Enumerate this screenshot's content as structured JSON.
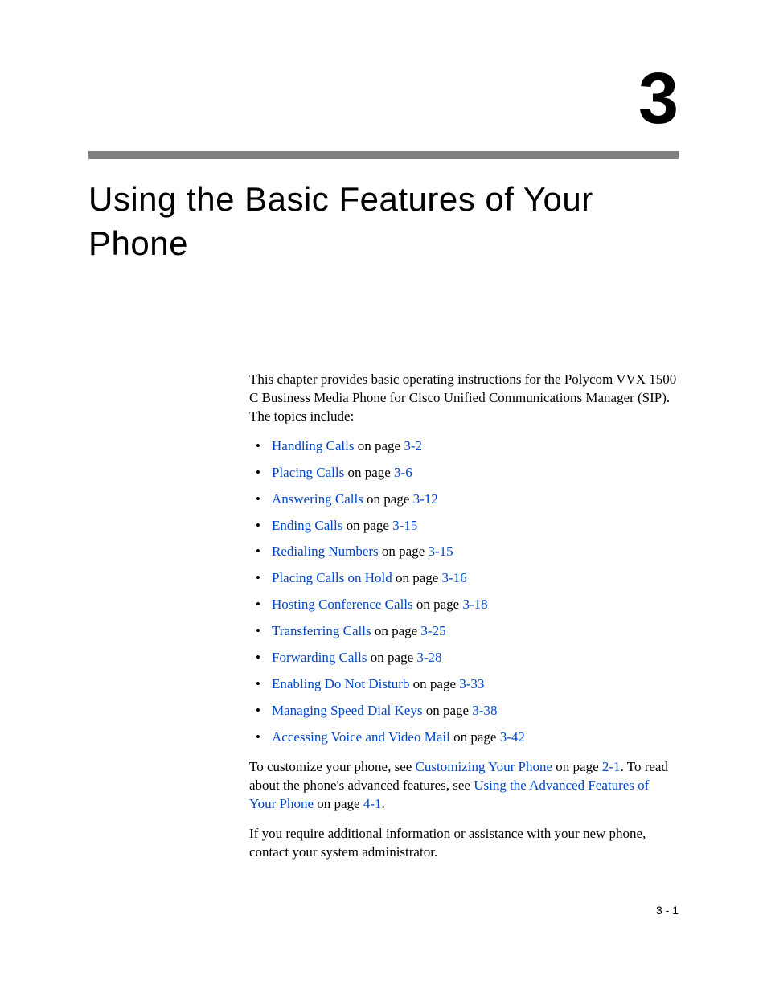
{
  "chapter": {
    "number": "3",
    "title": "Using the Basic Features of Your Phone"
  },
  "intro": "This chapter provides basic operating instructions for the Polycom VVX 1500 C Business Media Phone for Cisco Unified Communications Manager (SIP). The topics include:",
  "toc": [
    {
      "link": "Handling Calls",
      "mid": " on page ",
      "page": "3-2"
    },
    {
      "link": "Placing Calls",
      "mid": " on page ",
      "page": "3-6"
    },
    {
      "link": "Answering Calls",
      "mid": " on page ",
      "page": "3-12"
    },
    {
      "link": "Ending Calls",
      "mid": " on page ",
      "page": "3-15"
    },
    {
      "link": "Redialing Numbers",
      "mid": " on page ",
      "page": "3-15"
    },
    {
      "link": "Placing Calls on Hold",
      "mid": " on page ",
      "page": "3-16"
    },
    {
      "link": "Hosting Conference Calls",
      "mid": " on page ",
      "page": "3-18"
    },
    {
      "link": "Transferring Calls",
      "mid": " on page ",
      "page": "3-25"
    },
    {
      "link": "Forwarding Calls",
      "mid": " on page ",
      "page": "3-28"
    },
    {
      "link": "Enabling Do Not Disturb",
      "mid": " on page ",
      "page": "3-33"
    },
    {
      "link": "Managing Speed Dial Keys",
      "mid": " on page ",
      "page": "3-38"
    },
    {
      "link": "Accessing Voice and Video Mail",
      "mid": " on page ",
      "page": "3-42"
    }
  ],
  "closing1": {
    "pre": "To customize your phone, see ",
    "link1": "Customizing Your Phone",
    "mid1": " on page ",
    "page1": "2-1",
    "mid2": ". To read about the phone's advanced features, see ",
    "link2": "Using the Advanced Features of Your Phone",
    "mid3": " on page ",
    "page2": "4-1",
    "post": "."
  },
  "closing2": "If you require additional information or assistance with your new phone, contact your system administrator.",
  "footer": {
    "pageLabel": "3 - 1"
  }
}
